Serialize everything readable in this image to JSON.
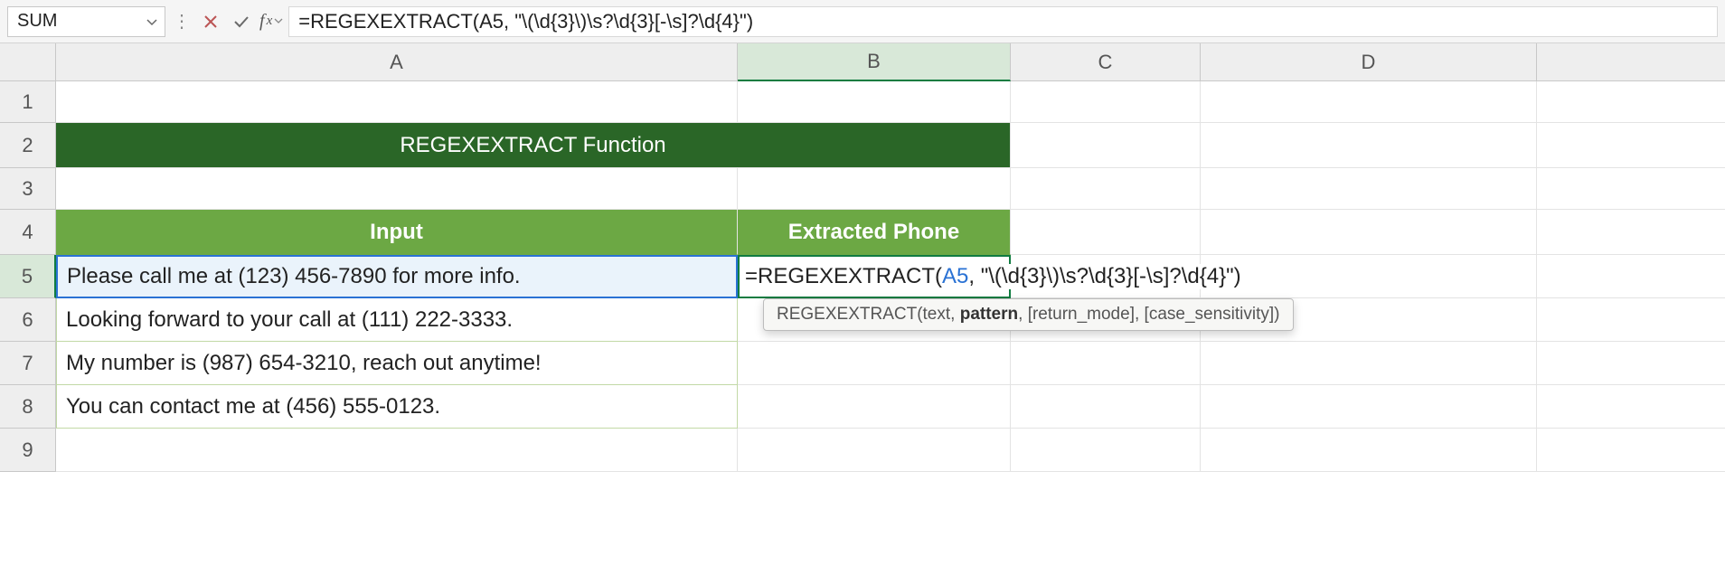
{
  "formula_bar": {
    "name_box_value": "SUM",
    "formula": "=REGEXEXTRACT(A5, \"\\(\\d{3}\\)\\s?\\d{3}[-\\s]?\\d{4}\")"
  },
  "columns": [
    "A",
    "B",
    "C",
    "D"
  ],
  "rows": [
    "1",
    "2",
    "3",
    "4",
    "5",
    "6",
    "7",
    "8",
    "9"
  ],
  "title_cell": "REGEXEXTRACT Function",
  "headers": {
    "a4": "Input",
    "b4": "Extracted Phone"
  },
  "inputs": {
    "a5": "Please call me at (123) 456-7890 for more info.",
    "a6": "Looking forward to your call at (111) 222-3333.",
    "a7": "My number is (987) 654-3210,  reach out anytime!",
    "a8": "You can contact me at (456) 555-0123."
  },
  "editing": {
    "prefix": "=REGEXEXTRACT(",
    "ref": "A5",
    "suffix": ", \"\\(\\d{3}\\)\\s?\\d{3}[-\\s]?\\d{4}\")"
  },
  "tooltip": {
    "func": "REGEXEXTRACT",
    "p1": "text",
    "p2": "pattern",
    "p3": "[return_mode]",
    "p4": "[case_sensitivity]"
  },
  "chart_data": {
    "type": "table",
    "title": "REGEXEXTRACT Function",
    "columns": [
      "Input",
      "Extracted Phone"
    ],
    "rows": [
      {
        "Input": "Please call me at (123) 456-7890 for more info.",
        "Extracted Phone": "=REGEXEXTRACT(A5, \"\\(\\d{3}\\)\\s?\\d{3}[-\\s]?\\d{4}\")"
      },
      {
        "Input": "Looking forward to your call at (111) 222-3333.",
        "Extracted Phone": ""
      },
      {
        "Input": "My number is (987) 654-3210,  reach out anytime!",
        "Extracted Phone": ""
      },
      {
        "Input": "You can contact me at (456) 555-0123.",
        "Extracted Phone": ""
      }
    ]
  }
}
